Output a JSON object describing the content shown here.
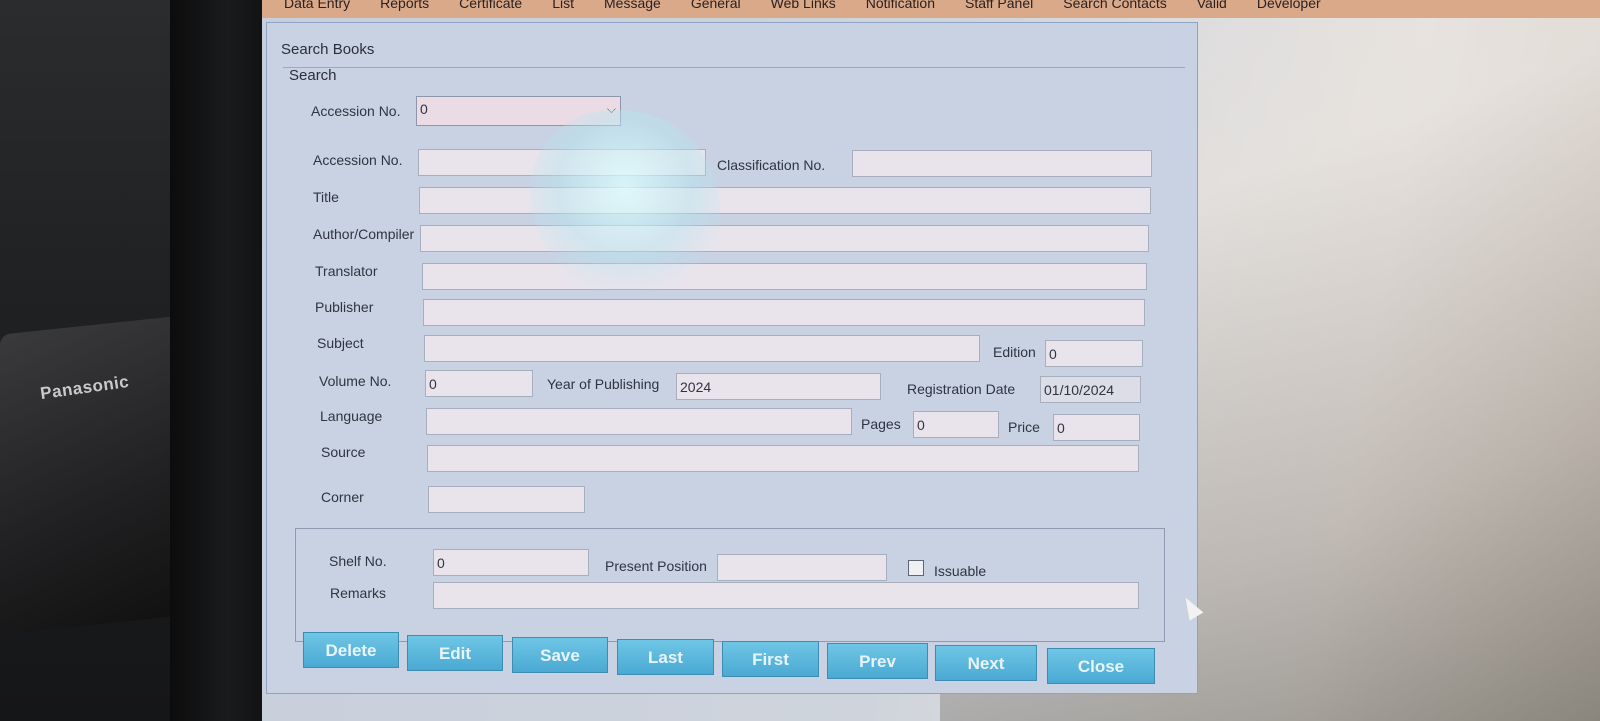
{
  "device": {
    "brand": "Panasonic"
  },
  "menu": {
    "items": [
      "Data Entry",
      "Reports",
      "Certificate",
      "List",
      "Message",
      "General",
      "Web Links",
      "Notification",
      "Staff Panel",
      "Search Contacts",
      "Valid",
      "Developer"
    ]
  },
  "form": {
    "title": "Search Books",
    "search_group_label": "Search",
    "search": {
      "label": "Accession No.",
      "value": "0"
    },
    "fields": {
      "accession_no": {
        "label": "Accession No.",
        "value": ""
      },
      "classification_no": {
        "label": "Classification No.",
        "value": ""
      },
      "title": {
        "label": "Title",
        "value": ""
      },
      "author": {
        "label": "Author/Compiler",
        "value": ""
      },
      "translator": {
        "label": "Translator",
        "value": ""
      },
      "publisher": {
        "label": "Publisher",
        "value": ""
      },
      "subject": {
        "label": "Subject",
        "value": ""
      },
      "edition": {
        "label": "Edition",
        "value": "0"
      },
      "volume_no": {
        "label": "Volume No.",
        "value": "0"
      },
      "year_of_publishing": {
        "label": "Year of Publishing",
        "value": "2024"
      },
      "registration_date": {
        "label": "Registration Date",
        "value": "01/10/2024"
      },
      "language": {
        "label": "Language",
        "value": ""
      },
      "pages": {
        "label": "Pages",
        "value": "0"
      },
      "price": {
        "label": "Price",
        "value": "0"
      },
      "source": {
        "label": "Source",
        "value": ""
      },
      "corner": {
        "label": "Corner",
        "value": ""
      },
      "shelf_no": {
        "label": "Shelf No.",
        "value": "0"
      },
      "present_position": {
        "label": "Present Position",
        "value": ""
      },
      "issuable": {
        "label": "Issuable",
        "checked": false
      },
      "remarks": {
        "label": "Remarks",
        "value": ""
      }
    },
    "buttons": {
      "delete": "Delete",
      "edit": "Edit",
      "save": "Save",
      "last": "Last",
      "first": "First",
      "prev": "Prev",
      "next": "Next",
      "close": "Close"
    }
  }
}
